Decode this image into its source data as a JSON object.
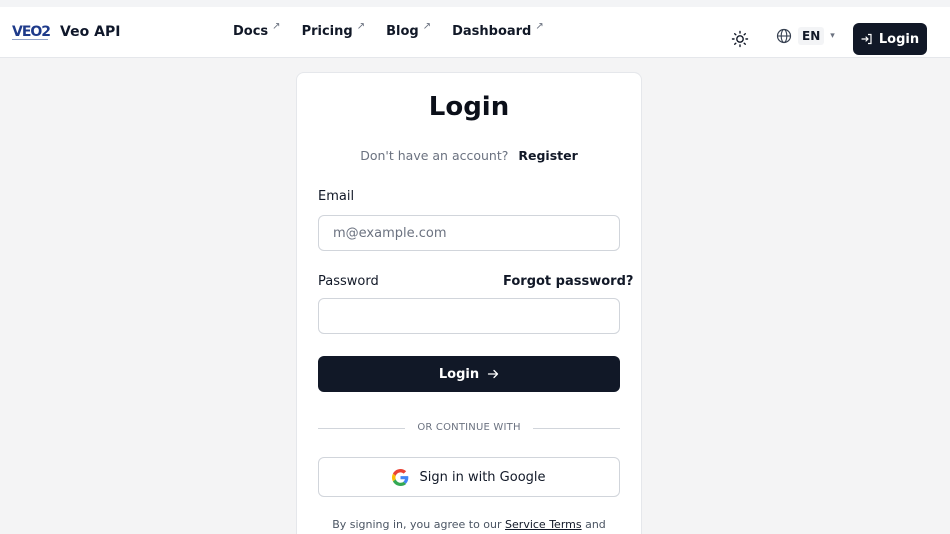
{
  "header": {
    "logo_text": "VEO2",
    "brand": "Veo API",
    "nav": [
      {
        "label": "Docs",
        "ext": "↗"
      },
      {
        "label": "Pricing",
        "ext": "↗"
      },
      {
        "label": "Blog",
        "ext": "↗"
      },
      {
        "label": "Dashboard",
        "ext": "↗"
      }
    ],
    "language": "EN",
    "login_label": "Login"
  },
  "login_form": {
    "title": "Login",
    "no_account_text": "Don't have an account?",
    "register_link": "Register",
    "email_label": "Email",
    "email_placeholder": "m@example.com",
    "email_value": "",
    "password_label": "Password",
    "forgot_link": "Forgot password?",
    "password_value": "",
    "submit_label": "Login",
    "divider_text": "OR CONTINUE WITH",
    "google_label": "Sign in with Google",
    "terms_prefix": "By signing in, you agree to our",
    "terms_link": "Service Terms",
    "terms_suffix": "and"
  },
  "colors": {
    "primary": "#111827",
    "page_bg": "#f4f4f5",
    "brand_logo": "#1e3a8a"
  },
  "icons": {
    "theme": "sun-icon",
    "language": "globe-icon",
    "login": "sign-in-icon",
    "submit": "arrow-right-icon",
    "google": "google-logo-icon"
  }
}
